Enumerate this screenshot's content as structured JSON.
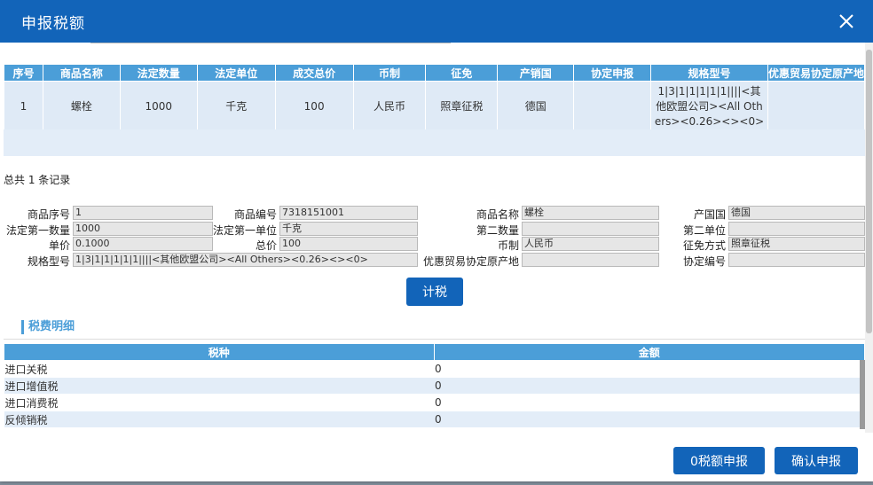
{
  "dialog": {
    "title": "申报税额"
  },
  "goods_table": {
    "headers": [
      "序号",
      "商品名称",
      "法定数量",
      "法定单位",
      "成交总价",
      "币制",
      "征免",
      "产销国",
      "协定申报",
      "规格型号",
      "优惠贸易协定原产地"
    ],
    "rows": [
      [
        "1",
        "螺栓",
        "1000",
        "千克",
        "100",
        "人民币",
        "照章征税",
        "德国",
        "",
        "1|3|1|1|1|1|1||||<其他欧盟公司><All Others><0.26><><0>",
        ""
      ]
    ]
  },
  "total_records": "总共 1 条记录",
  "form": {
    "item_no_label": "商品序号",
    "item_no": "1",
    "code_label": "商品编号",
    "code": "7318151001",
    "name_label": "商品名称",
    "name": "螺栓",
    "origin_label": "产国国",
    "origin": "德国",
    "qty1_label": "法定第一数量",
    "qty1": "1000",
    "unit1_label": "法定第一单位",
    "unit1": "千克",
    "qty2_label": "第二数量",
    "qty2": "",
    "unit2_label": "第二单位",
    "unit2": "",
    "price_label": "单价",
    "price": "0.1000",
    "total_label": "总价",
    "total": "100",
    "currency_label": "币制",
    "currency": "人民币",
    "exemption_label": "征免方式",
    "exemption": "照章征税",
    "spec_label": "规格型号",
    "spec": "1|3|1|1|1|1|1||||<其他欧盟公司><All Others><0.26><><0>",
    "pref_origin_label": "优惠贸易协定原产地",
    "pref_origin": "",
    "agreement_no_label": "协定编号",
    "agreement_no": ""
  },
  "calc_button": "计税",
  "tax_section": {
    "title": "税费明细",
    "headers": [
      "税种",
      "金额"
    ],
    "rows": [
      {
        "type": "进口关税",
        "amount": "0"
      },
      {
        "type": "进口增值税",
        "amount": "0"
      },
      {
        "type": "进口消费税",
        "amount": "0"
      },
      {
        "type": "反倾销税",
        "amount": "0"
      }
    ]
  },
  "footer": {
    "zero_declare": "0税额申报",
    "confirm_declare": "确认申报"
  },
  "colors": {
    "title_bar": "#1264b9",
    "header_blue": "#4b9ed8",
    "row_bg": "#dfeaf6"
  }
}
